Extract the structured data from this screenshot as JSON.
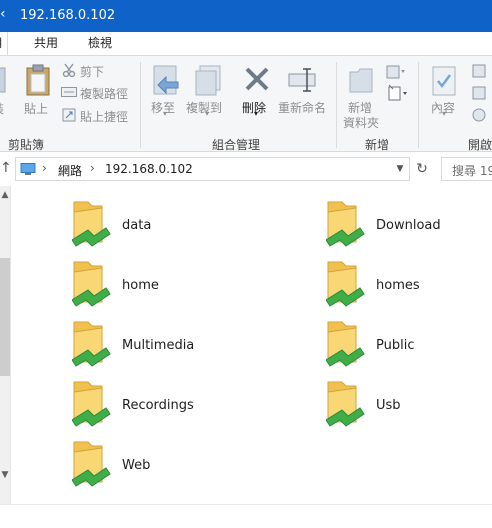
{
  "window": {
    "title": "192.168.0.102"
  },
  "tabs": {
    "file": "用",
    "share": "共用",
    "view": "檢視"
  },
  "ribbon": {
    "clipboard": {
      "partial_left": "裝",
      "paste": "貼上",
      "cut": "剪下",
      "copy_path": "複製路徑",
      "paste_shortcut": "貼上捷徑",
      "group": "剪貼簿"
    },
    "organize": {
      "move_to": "移至",
      "copy_to": "複製到",
      "delete": "刪除",
      "rename": "重新命名",
      "group": "組合管理"
    },
    "new": {
      "new_folder_line1": "新增",
      "new_folder_line2": "資料夾",
      "group": "新增"
    },
    "open": {
      "properties": "內容",
      "group": "開啟"
    }
  },
  "address": {
    "crumbs": [
      "網路",
      "192.168.0.102"
    ],
    "search_placeholder": "搜尋 19"
  },
  "folders": [
    {
      "name": "data"
    },
    {
      "name": "Download"
    },
    {
      "name": "home"
    },
    {
      "name": "homes"
    },
    {
      "name": "Multimedia"
    },
    {
      "name": "Public"
    },
    {
      "name": "Recordings"
    },
    {
      "name": "Usb"
    },
    {
      "name": "Web"
    }
  ]
}
